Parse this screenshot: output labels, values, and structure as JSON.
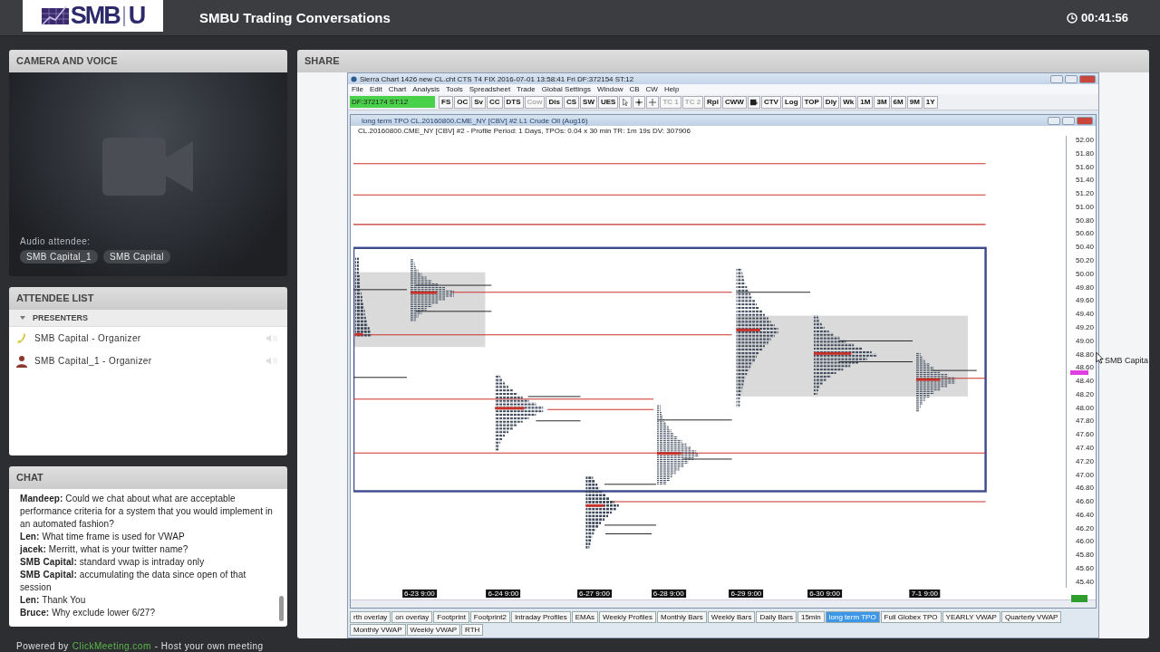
{
  "header": {
    "logo_text": "SMB",
    "logo_letter": "U",
    "title": "SMBU Trading Conversations",
    "timer": "00:41:56"
  },
  "camera_panel": {
    "title": "CAMERA AND VOICE",
    "audio_label": "Audio attendee:",
    "audio_attendees": [
      "SMB Capital_1",
      "SMB Capital"
    ]
  },
  "attendee_panel": {
    "title": "ATTENDEE LIST",
    "groups": [
      {
        "label": "PRESENTERS",
        "expanded": true,
        "members": [
          {
            "name": "SMB Capital - Organizer",
            "kind": "phone"
          },
          {
            "name": "SMB Capital_1 - Organizer",
            "kind": "person"
          }
        ]
      }
    ]
  },
  "chat_panel": {
    "title": "CHAT",
    "messages": [
      "**Mandeep:** Could we chat about what are acceptable performance criteria for a system that you would implement in an automated fashion?",
      "**Len:** What time frame is used for VWAP",
      "**jacek:** Merritt, what is your twitter name?",
      "**SMB Capital:** standard vwap is intraday only",
      "**SMB Capital:** accumulating the data since open of that session",
      "**Len:** Thank You",
      "**Bruce:** Why exclude lower 6/27?"
    ]
  },
  "footer": {
    "prefix": "Powered by",
    "link": "ClickMeeting.com",
    "suffix": "- Host your own meeting"
  },
  "share_panel": {
    "title": "SHARE",
    "cursor_label": "SMB Capita",
    "app": {
      "title": "Sierra Chart 1426 new CL.cht  CTS T4 FIX 2016-07-01  13:58:41 Fri  DF:372154  ST:12",
      "menu": [
        "File",
        "Edit",
        "Chart",
        "Analysis",
        "Tools",
        "Spreadsheet",
        "Trade",
        "Global Settings",
        "Window",
        "CB",
        "CW",
        "Help"
      ],
      "status": "DF:372174  ST:12",
      "toolbar": [
        {
          "kind": "text",
          "label": "FS",
          "disabled": false
        },
        {
          "kind": "text",
          "label": "OC",
          "disabled": false
        },
        {
          "kind": "text",
          "label": "Sv",
          "disabled": false
        },
        {
          "kind": "text",
          "label": "CC",
          "disabled": false
        },
        {
          "kind": "text",
          "label": "DTS",
          "disabled": false
        },
        {
          "kind": "text",
          "label": "Cow",
          "disabled": true
        },
        {
          "kind": "text",
          "label": "Dis",
          "disabled": false
        },
        {
          "kind": "text",
          "label": "CS",
          "disabled": false
        },
        {
          "kind": "text",
          "label": "SW",
          "disabled": false
        },
        {
          "kind": "text",
          "label": "UES",
          "disabled": false
        },
        {
          "kind": "pointer"
        },
        {
          "kind": "crosshair"
        },
        {
          "kind": "crossline"
        },
        {
          "kind": "text",
          "label": "TC 1",
          "disabled": true
        },
        {
          "kind": "text",
          "label": "TC 2",
          "disabled": true
        },
        {
          "kind": "text",
          "label": "Rpl",
          "disabled": false
        },
        {
          "kind": "text",
          "label": "CWW",
          "disabled": false
        },
        {
          "kind": "chartbar"
        },
        {
          "kind": "text",
          "label": "CTV",
          "disabled": false
        },
        {
          "kind": "text",
          "label": "Log",
          "disabled": false
        },
        {
          "kind": "text",
          "label": "TOP",
          "disabled": false
        },
        {
          "kind": "text",
          "label": "Dly",
          "disabled": false
        },
        {
          "kind": "text",
          "label": "Wk",
          "disabled": false
        },
        {
          "kind": "text",
          "label": "1M",
          "disabled": false
        },
        {
          "kind": "text",
          "label": "3M",
          "disabled": false
        },
        {
          "kind": "text",
          "label": "6M",
          "disabled": false
        },
        {
          "kind": "text",
          "label": "9M",
          "disabled": false
        },
        {
          "kind": "text",
          "label": "1Y",
          "disabled": false
        }
      ],
      "chart": {
        "title": "long term TPO  CL.20160800.CME_NY [CBV]  #2  L1  Crude Oil (Aug16)",
        "info": "CL.20160800.CME_NY [CBV]  #2 - Profile Period: 1 Days, TPOs: 0.04 x 30 min   TR: 1m 19s DV: 307906",
        "price_labels": [
          "52.00",
          "51.80",
          "51.60",
          "51.40",
          "51.20",
          "51.00",
          "50.80",
          "50.60",
          "50.40",
          "50.20",
          "50.00",
          "49.80",
          "49.60",
          "49.40",
          "49.20",
          "49.00",
          "48.80",
          "48.60",
          "48.40",
          "48.20",
          "48.00",
          "47.80",
          "47.60",
          "47.40",
          "47.20",
          "47.00",
          "46.80",
          "46.60",
          "46.40",
          "46.20",
          "46.00",
          "45.80",
          "45.60",
          "45.40"
        ],
        "date_labels": [
          "6-23 9:00",
          "6-24 9:00",
          "6-27 9:00",
          "6-28 9:00",
          "6-29 9:00",
          "6-30 9:00",
          "7-1 9:00"
        ]
      },
      "tabs": [
        {
          "label": "rth overlay",
          "selected": false
        },
        {
          "label": "on overlay",
          "selected": false
        },
        {
          "label": "Footprint",
          "selected": false
        },
        {
          "label": "Footprint2",
          "selected": false
        },
        {
          "label": "Intraday Profiles",
          "selected": false
        },
        {
          "label": "EMAs",
          "selected": false
        },
        {
          "label": "Weekly Profiles",
          "selected": false
        },
        {
          "label": "Monthly Bars",
          "selected": false
        },
        {
          "label": "Weekly Bars",
          "selected": false
        },
        {
          "label": "Daily Bars",
          "selected": false
        },
        {
          "label": "15min",
          "selected": false
        },
        {
          "label": "long term TPO",
          "selected": true
        },
        {
          "label": "Full Globex TPO",
          "selected": false
        },
        {
          "label": "YEARLY VWAP",
          "selected": false
        },
        {
          "label": "Quarterly VWAP",
          "selected": false
        },
        {
          "label": "Monthly VWAP",
          "selected": false
        },
        {
          "label": "Weekly VWAP",
          "selected": false
        },
        {
          "label": "RTH",
          "selected": false
        }
      ]
    }
  }
}
